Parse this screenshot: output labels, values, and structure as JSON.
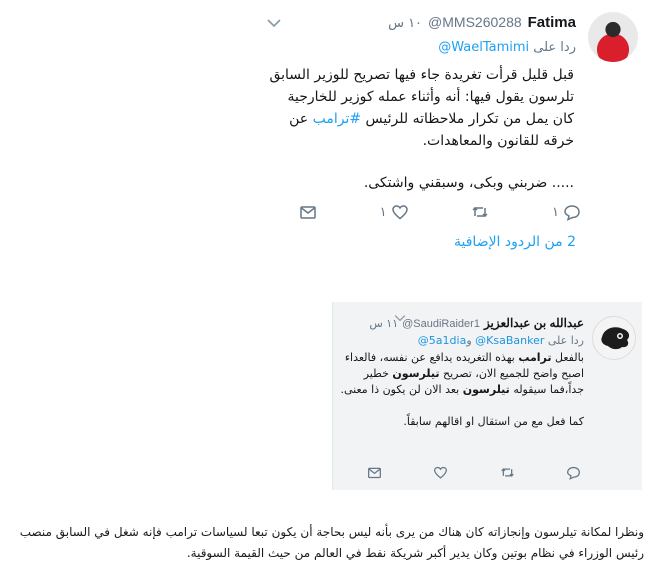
{
  "tweet1": {
    "name": "Fatima",
    "handle": "@MMS260288",
    "time": "١٠ س",
    "reply_prefix": "ردا على",
    "reply_to": "@WaelTamimi",
    "body_line1": "قبل قليل قرأت تغريدة جاء فيها تصريح للوزير السابق تلرسون يقول فيها: أنه وأثناء عمله كوزير للخارجية كان يمل من تكرار ملاحظاته للرئيس",
    "hashtag": "#ترامب",
    "body_line1_end": "عن خرقه للقانون والمعاهدات.",
    "body_line2": "..... ضربني وبكى، وسبقني واشتكى.",
    "reply_count": "١",
    "retweet_count": "",
    "like_count": "١",
    "more_replies": "2 من الردود الإضافية",
    "icons": [
      "chevron-down-icon",
      "reply-icon",
      "retweet-icon",
      "like-icon",
      "message-icon"
    ]
  },
  "tweet2": {
    "name": "عبدالله بن عبدالعزيز",
    "handle": "@SaudiRaider1",
    "time": "١١ س",
    "reply_prefix": "ردا على",
    "reply_to_1": "@KsaBanker",
    "reply_join": "و",
    "reply_to_2": "@5a1dia",
    "body_a": "بالفعل",
    "body_b": "ترامب",
    "body_c": "بهذه التغريده يدافع عن نفسه، فالعداء اصبح واضح للجميع الان، تصريح",
    "body_d": "تيلرسون",
    "body_e": "خطير جداً،فما سيقوله",
    "body_f": "تيلرسون",
    "body_g": "بعد الان لن يكون ذا معنى.",
    "body_line2": "كما فعل مع من استقال او اقالهم سابقاً.",
    "reply_count": "",
    "retweet_count": "",
    "like_count": ""
  },
  "article": {
    "text": "ونظرا لمكانة تيلرسون وإنجازاته كان هناك من يرى بأنه ليس بحاجة أن يكون تبعا لسياسات ترامب فإنه شغل في السابق منصب رئيس الوزراء في نظام بوتين وكان يدير أكبر شريكة نفط في العالم من حيث القيمة السوقية."
  }
}
